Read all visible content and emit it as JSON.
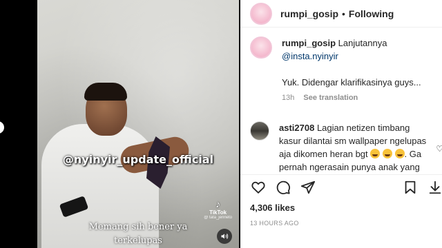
{
  "video": {
    "watermark": "@nyinyir_update_official",
    "tiktok_name": "TikTok",
    "tiktok_user": "@ tata_jenneto",
    "subtitle_line1": "Memang sih bener ya",
    "subtitle_line2": "terkelupas"
  },
  "header": {
    "username": "rumpi_gosip",
    "separator": "•",
    "follow_status": "Following"
  },
  "caption": {
    "username": "rumpi_gosip",
    "text": "Lanjutannya",
    "mention": "@insta.nyinyir",
    "text2": "Yuk. Didengar klarifikasinya guys...",
    "time": "13h",
    "translate_label": "See translation"
  },
  "comment": {
    "username": "asti2708",
    "text_part1": "Lagian netizen timbang kasur dilantai sm wallpaper ngelupas aja dikomen heran bgt",
    "text_part2": ". Ga pernah ngerasain punya anak yang lagi aktif-aktifnya nyusruk"
  },
  "post": {
    "likes": "4,306 likes",
    "timestamp": "13 HOURS AGO"
  }
}
